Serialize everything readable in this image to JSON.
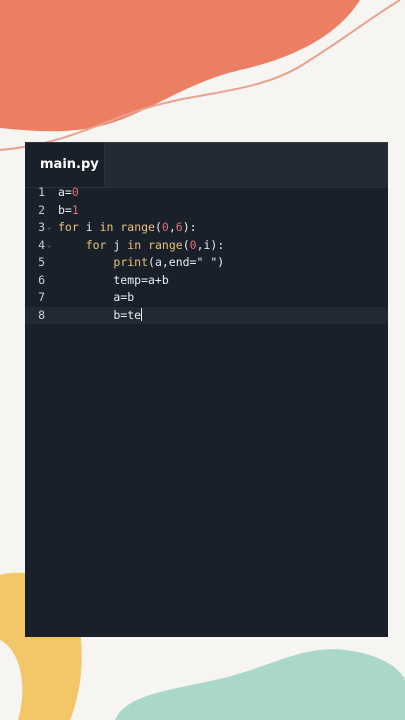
{
  "editor": {
    "tab_title": "main.py",
    "fold_marker": "⌄",
    "colors": {
      "keyword": "#e6c07b",
      "builtin": "#e6c07b",
      "number": "#e06c75",
      "text": "#e9edf2",
      "line_number": "#c9ced6",
      "background": "#1a2029",
      "tabbar": "#232a33"
    },
    "lines": [
      {
        "number": "1",
        "fold": false,
        "current": false,
        "segments": [
          {
            "t": "a=",
            "k": "text"
          },
          {
            "t": "0",
            "k": "number"
          }
        ]
      },
      {
        "number": "2",
        "fold": false,
        "current": false,
        "segments": [
          {
            "t": "b=",
            "k": "text"
          },
          {
            "t": "1",
            "k": "number"
          }
        ]
      },
      {
        "number": "3",
        "fold": true,
        "current": false,
        "segments": [
          {
            "t": "for",
            "k": "keyword"
          },
          {
            "t": " i ",
            "k": "text"
          },
          {
            "t": "in",
            "k": "keyword"
          },
          {
            "t": " ",
            "k": "text"
          },
          {
            "t": "range",
            "k": "builtin"
          },
          {
            "t": "(",
            "k": "text"
          },
          {
            "t": "0",
            "k": "number"
          },
          {
            "t": ",",
            "k": "text"
          },
          {
            "t": "6",
            "k": "number"
          },
          {
            "t": "):",
            "k": "text"
          }
        ]
      },
      {
        "number": "4",
        "fold": true,
        "current": false,
        "segments": [
          {
            "t": "    ",
            "k": "text"
          },
          {
            "t": "for",
            "k": "keyword"
          },
          {
            "t": " j ",
            "k": "text"
          },
          {
            "t": "in",
            "k": "keyword"
          },
          {
            "t": " ",
            "k": "text"
          },
          {
            "t": "range",
            "k": "builtin"
          },
          {
            "t": "(",
            "k": "text"
          },
          {
            "t": "0",
            "k": "number"
          },
          {
            "t": ",i):",
            "k": "text"
          }
        ]
      },
      {
        "number": "5",
        "fold": false,
        "current": false,
        "segments": [
          {
            "t": "        ",
            "k": "text"
          },
          {
            "t": "print",
            "k": "builtin"
          },
          {
            "t": "(a,end=\" \")",
            "k": "text"
          }
        ]
      },
      {
        "number": "6",
        "fold": false,
        "current": false,
        "segments": [
          {
            "t": "        temp=a+b",
            "k": "text"
          }
        ]
      },
      {
        "number": "7",
        "fold": false,
        "current": false,
        "segments": [
          {
            "t": "        a=b",
            "k": "text"
          }
        ]
      },
      {
        "number": "8",
        "fold": false,
        "current": true,
        "segments": [
          {
            "t": "        b=te",
            "k": "text"
          }
        ]
      }
    ]
  }
}
